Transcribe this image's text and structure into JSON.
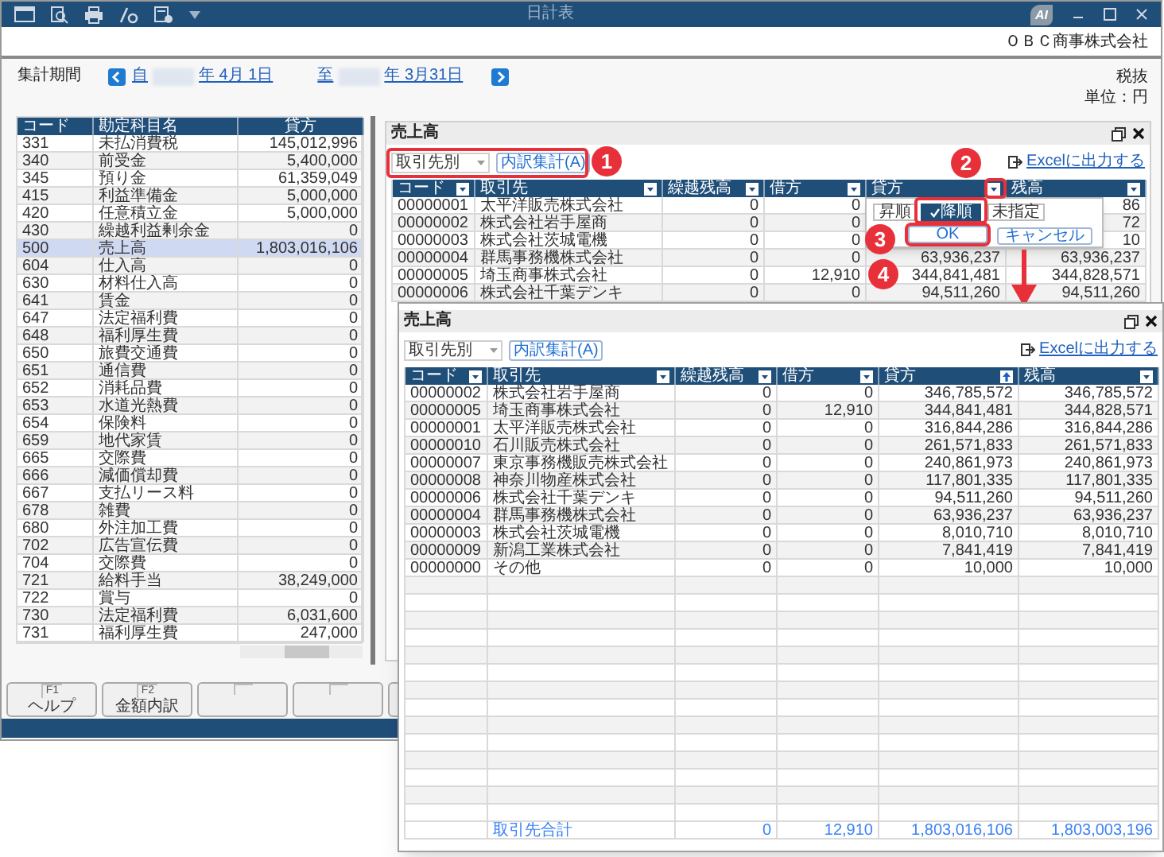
{
  "window": {
    "title": "日計表",
    "logo_text": "AI"
  },
  "company": "ＯＢＣ商事株式会社",
  "period": {
    "label": "集計期間",
    "from_prefix": "自",
    "start_date": "年  4月 1日",
    "to_prefix": "至",
    "end_date": "年  3月31日"
  },
  "tax_mode": "税抜",
  "unit": "単位：円",
  "accounts": {
    "columns": [
      "コード",
      "勘定科目名",
      "貸方"
    ],
    "rows": [
      {
        "cells": [
          "331",
          "未払消費税",
          "145,012,996"
        ],
        "selected": false
      },
      {
        "cells": [
          "340",
          "前受金",
          "5,400,000"
        ],
        "selected": false
      },
      {
        "cells": [
          "345",
          "預り金",
          "61,359,049"
        ],
        "selected": false
      },
      {
        "cells": [
          "415",
          "利益準備金",
          "5,000,000"
        ],
        "selected": false
      },
      {
        "cells": [
          "420",
          "任意積立金",
          "5,000,000"
        ],
        "selected": false
      },
      {
        "cells": [
          "430",
          "繰越利益剰余金",
          "0"
        ],
        "selected": false
      },
      {
        "cells": [
          "500",
          "売上高",
          "1,803,016,106"
        ],
        "selected": true
      },
      {
        "cells": [
          "604",
          "仕入高",
          "0"
        ],
        "selected": false
      },
      {
        "cells": [
          "630",
          "材料仕入高",
          "0"
        ],
        "selected": false
      },
      {
        "cells": [
          "641",
          "賃金",
          "0"
        ],
        "selected": false
      },
      {
        "cells": [
          "647",
          "法定福利費",
          "0"
        ],
        "selected": false
      },
      {
        "cells": [
          "648",
          "福利厚生費",
          "0"
        ],
        "selected": false
      },
      {
        "cells": [
          "650",
          "旅費交通費",
          "0"
        ],
        "selected": false
      },
      {
        "cells": [
          "651",
          "通信費",
          "0"
        ],
        "selected": false
      },
      {
        "cells": [
          "652",
          "消耗品費",
          "0"
        ],
        "selected": false
      },
      {
        "cells": [
          "653",
          "水道光熱費",
          "0"
        ],
        "selected": false
      },
      {
        "cells": [
          "654",
          "保険料",
          "0"
        ],
        "selected": false
      },
      {
        "cells": [
          "659",
          "地代家賃",
          "0"
        ],
        "selected": false
      },
      {
        "cells": [
          "665",
          "交際費",
          "0"
        ],
        "selected": false
      },
      {
        "cells": [
          "666",
          "減価償却費",
          "0"
        ],
        "selected": false
      },
      {
        "cells": [
          "667",
          "支払リース料",
          "0"
        ],
        "selected": false
      },
      {
        "cells": [
          "678",
          "雑費",
          "0"
        ],
        "selected": false
      },
      {
        "cells": [
          "680",
          "外注加工費",
          "0"
        ],
        "selected": false
      },
      {
        "cells": [
          "702",
          "広告宣伝費",
          "0"
        ],
        "selected": false
      },
      {
        "cells": [
          "704",
          "交際費",
          "0"
        ],
        "selected": false
      },
      {
        "cells": [
          "721",
          "給料手当",
          "38,249,000"
        ],
        "selected": false
      },
      {
        "cells": [
          "722",
          "賞与",
          "0"
        ],
        "selected": false
      },
      {
        "cells": [
          "730",
          "法定福利費",
          "6,031,600"
        ],
        "selected": false
      },
      {
        "cells": [
          "731",
          "福利厚生費",
          "247,000"
        ],
        "selected": false
      }
    ]
  },
  "detail": {
    "title": "売上高",
    "group_by": "取引先別",
    "aggregate_button": "内訳集計(A)",
    "export_link": "Excelに出力する",
    "columns": [
      {
        "label": "コード",
        "sorted": false
      },
      {
        "label": "取引先",
        "sorted": false
      },
      {
        "label": "繰越残高",
        "sorted": false
      },
      {
        "label": "借方",
        "sorted": false
      },
      {
        "label": "貸方",
        "sorted": false
      },
      {
        "label": "残高",
        "sorted": false
      }
    ],
    "rows": [
      {
        "cells": [
          "00000001",
          "太平洋販売株式会社",
          "0",
          "0",
          null,
          "86"
        ]
      },
      {
        "cells": [
          "00000002",
          "株式会社岩手屋商",
          "0",
          "0",
          null,
          "72"
        ]
      },
      {
        "cells": [
          "00000003",
          "株式会社茨城電機",
          "0",
          "0",
          null,
          "10"
        ]
      },
      {
        "cells": [
          "00000004",
          "群馬事務機株式会社",
          "0",
          "0",
          "63,936,237",
          "63,936,237"
        ]
      },
      {
        "cells": [
          "00000005",
          "埼玉商事株式会社",
          "0",
          "12,910",
          "344,841,481",
          "344,828,571"
        ]
      },
      {
        "cells": [
          "00000006",
          "株式会社千葉デンキ",
          "0",
          "0",
          "94,511,260",
          "94,511,260"
        ]
      }
    ],
    "sort_menu": {
      "options": [
        {
          "label": "昇順",
          "selected": false
        },
        {
          "label": "降順",
          "selected": true
        },
        {
          "label": "未指定",
          "selected": false
        }
      ],
      "ok": "OK",
      "cancel": "キャンセル"
    }
  },
  "function_keys": [
    {
      "kind": "labeled",
      "key": "F1",
      "label": "ヘルプ"
    },
    {
      "kind": "labeled",
      "key": "F2",
      "label": "金額内訳"
    },
    {
      "kind": "blank"
    },
    {
      "kind": "blank"
    },
    {
      "kind": "blank"
    }
  ],
  "result_window": {
    "title": "売上高",
    "group_by": "取引先別",
    "aggregate_button": "内訳集計(A)",
    "export_link": "Excelに出力する",
    "columns": [
      {
        "label": "コード",
        "sorted": false
      },
      {
        "label": "取引先",
        "sorted": false
      },
      {
        "label": "繰越残高",
        "sorted": false
      },
      {
        "label": "借方",
        "sorted": false
      },
      {
        "label": "貸方",
        "sorted": true
      },
      {
        "label": "残高",
        "sorted": false
      }
    ],
    "rows": [
      {
        "cells": [
          "00000002",
          "株式会社岩手屋商",
          "0",
          "0",
          "346,785,572",
          "346,785,572"
        ]
      },
      {
        "cells": [
          "00000005",
          "埼玉商事株式会社",
          "0",
          "12,910",
          "344,841,481",
          "344,828,571"
        ]
      },
      {
        "cells": [
          "00000001",
          "太平洋販売株式会社",
          "0",
          "0",
          "316,844,286",
          "316,844,286"
        ]
      },
      {
        "cells": [
          "00000010",
          "石川販売株式会社",
          "0",
          "0",
          "261,571,833",
          "261,571,833"
        ]
      },
      {
        "cells": [
          "00000007",
          "東京事務機販売株式会社",
          "0",
          "0",
          "240,861,973",
          "240,861,973"
        ]
      },
      {
        "cells": [
          "00000008",
          "神奈川物産株式会社",
          "0",
          "0",
          "117,801,335",
          "117,801,335"
        ]
      },
      {
        "cells": [
          "00000006",
          "株式会社千葉デンキ",
          "0",
          "0",
          "94,511,260",
          "94,511,260"
        ]
      },
      {
        "cells": [
          "00000004",
          "群馬事務機株式会社",
          "0",
          "0",
          "63,936,237",
          "63,936,237"
        ]
      },
      {
        "cells": [
          "00000003",
          "株式会社茨城電機",
          "0",
          "0",
          "8,010,710",
          "8,010,710"
        ]
      },
      {
        "cells": [
          "00000009",
          "新潟工業株式会社",
          "0",
          "0",
          "7,841,419",
          "7,841,419"
        ]
      },
      {
        "cells": [
          "00000000",
          "その他",
          "0",
          "0",
          "10,000",
          "10,000"
        ]
      }
    ],
    "total": {
      "label": "取引先合計",
      "cells": [
        "0",
        "12,910",
        "1,803,016,106",
        "1,803,003,196"
      ]
    }
  },
  "annotations": [
    {
      "label": "1"
    },
    {
      "label": "2"
    },
    {
      "label": "3"
    },
    {
      "label": "4"
    }
  ]
}
